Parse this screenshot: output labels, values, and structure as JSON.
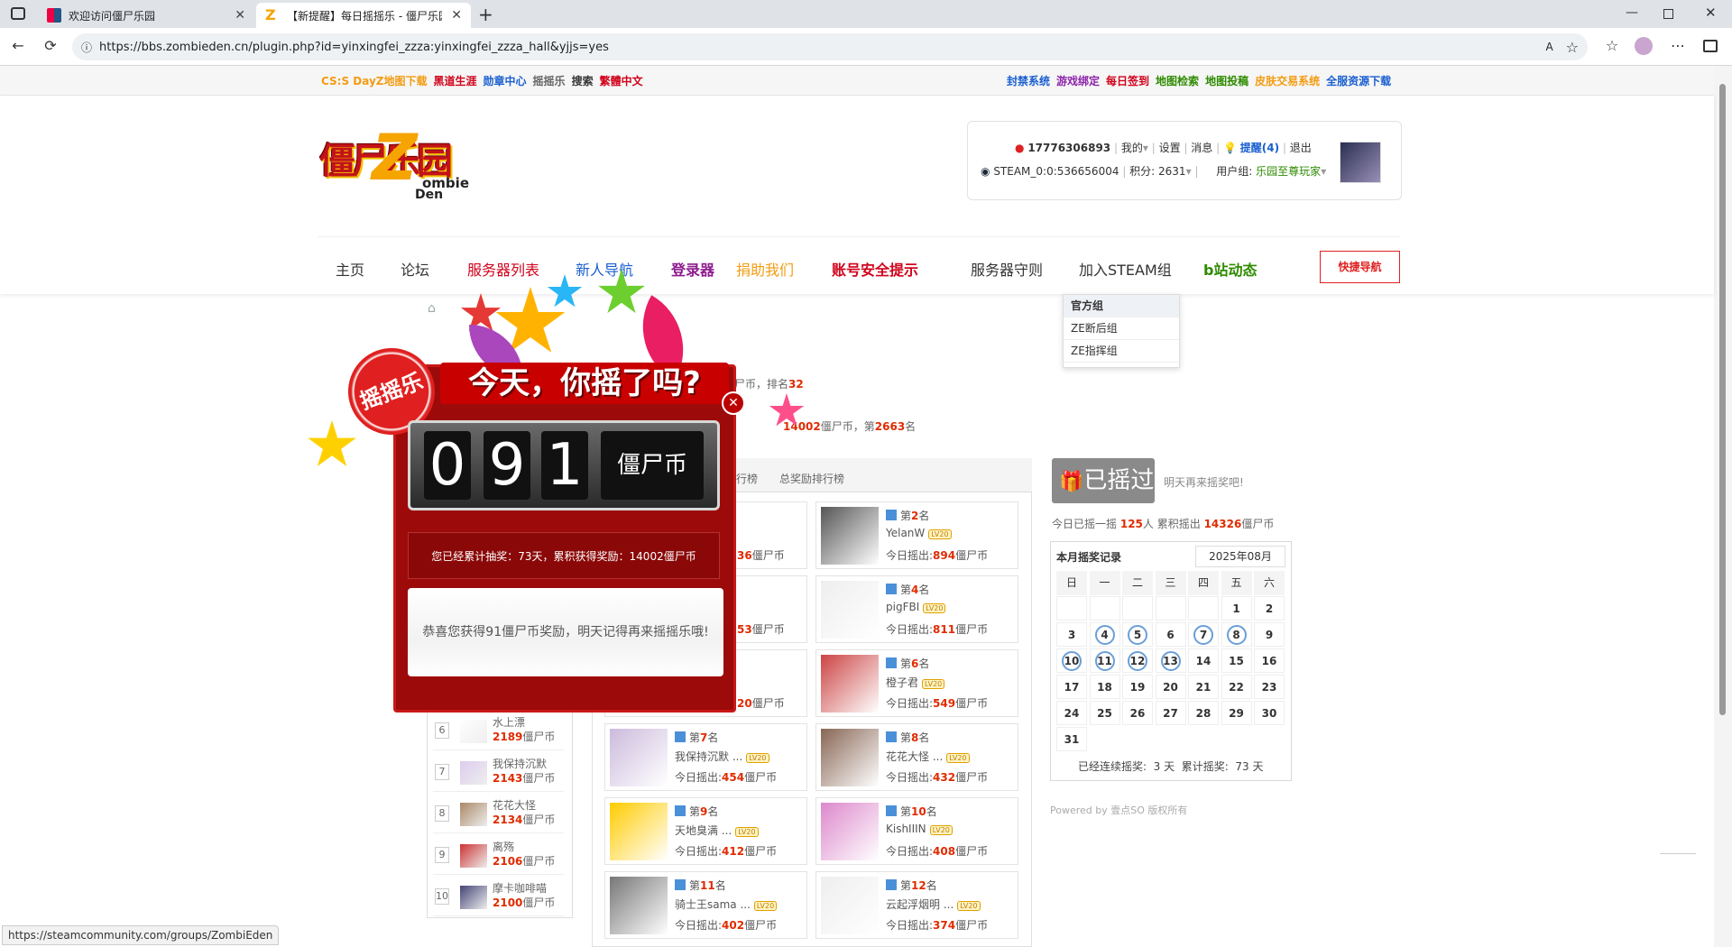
{
  "browser": {
    "tabs": [
      {
        "title": "欢迎访问僵尸乐园"
      },
      {
        "title": "【新提醒】每日摇摇乐 - 僵尸乐园"
      }
    ],
    "url": "https://bbs.zombieden.cn/plugin.php?id=yinxingfei_zzza:yinxingfei_zzza_hall&yjjs=yes",
    "status_url": "https://steamcommunity.com/groups/ZombiEden"
  },
  "topbar": {
    "left": [
      {
        "label": "CS:S DayZ地图下载",
        "color": "#f39c12"
      },
      {
        "label": "黑道生涯",
        "color": "#d0021b"
      },
      {
        "label": "勋章中心",
        "color": "#1a5fd0"
      },
      {
        "label": "摇摇乐",
        "color": "#666666"
      },
      {
        "label": "搜索",
        "color": "#333333"
      },
      {
        "label": "繁體中文",
        "color": "#d0021b"
      }
    ],
    "right": [
      {
        "label": "封禁系统",
        "color": "#1a5fd0"
      },
      {
        "label": "游戏绑定",
        "color": "#8e24aa"
      },
      {
        "label": "每日签到",
        "color": "#d0021b"
      },
      {
        "label": "地图检索",
        "color": "#2e8b00"
      },
      {
        "label": "地图投稿",
        "color": "#2e8b00"
      },
      {
        "label": "皮肤交易系统",
        "color": "#f39c12"
      },
      {
        "label": "全服资源下载",
        "color": "#1a5fd0"
      }
    ]
  },
  "logo": {
    "cn": "僵尸乐园",
    "en1": "ombie",
    "en2": "Den"
  },
  "user": {
    "qq": "17776306893",
    "my": "我的",
    "settings": "设置",
    "messages": "消息",
    "remind": "提醒(4)",
    "logout": "退出",
    "steam": "STEAM_0:0:536656004",
    "points": "积分: 2631",
    "group_label": "用户组:",
    "group": "乐园至尊玩家"
  },
  "nav": [
    {
      "label": "主页",
      "color": "#333333",
      "bold": false
    },
    {
      "label": "论坛",
      "color": "#333333",
      "bold": false
    },
    {
      "label": "服务器列表",
      "color": "#d0021b",
      "bold": false
    },
    {
      "label": "新人导航",
      "color": "#1a5fd0",
      "bold": false
    },
    {
      "label": "登录器",
      "color": "#8e1a8e",
      "bold": true
    },
    {
      "label": "捐助我们",
      "color": "#f39c12",
      "bold": false
    },
    {
      "label": "账号安全提示",
      "color": "#d0021b",
      "bold": true
    },
    {
      "label": "服务器守则",
      "color": "#333333",
      "bold": false
    },
    {
      "label": "加入STEAM组",
      "color": "#333333",
      "bold": false
    },
    {
      "label": "b站动态",
      "color": "#2e8b00",
      "bold": true
    }
  ],
  "quick_nav": "快捷导航",
  "dropdown": [
    "官方组",
    "ZE断后组",
    "ZE指挥组"
  ],
  "profile": {
    "rank_text": "僵尸币，排名",
    "rank": "32",
    "coins": "14002",
    "coins_suffix": "僵尸币，第",
    "pos": "2663",
    "pos_suffix": "名"
  },
  "tabs_rank": [
    "行榜",
    "总奖励排行榜"
  ],
  "popup": {
    "badge": "摇摇乐",
    "headline": "今天，你摇了吗?",
    "digits": [
      "0",
      "9",
      "1"
    ],
    "unit": "僵尸币",
    "summary": "您已经累计抽奖：73天，累积获得奖励：14002僵尸币",
    "message": "恭喜您获得91僵尸币奖励，明天记得再来摇摇乐哦!"
  },
  "cards": [
    {
      "rank": "2",
      "name": "YelanW",
      "amount": "894"
    },
    {
      "rank": "4",
      "name": "pigFBI",
      "amount": "811"
    },
    {
      "rank": "6",
      "name": "橙子君",
      "amount": "549"
    },
    {
      "rank": "7",
      "name": "我保持沉默 ...",
      "amount": "454"
    },
    {
      "rank": "8",
      "name": "花花大怪 ...",
      "amount": "432"
    },
    {
      "rank": "9",
      "name": "天地臭满 ...",
      "amount": "412"
    },
    {
      "rank": "10",
      "name": "KishIIIN",
      "amount": "408"
    },
    {
      "rank": "11",
      "name": "骑士王sama ...",
      "amount": "402"
    },
    {
      "rank": "12",
      "name": "云起浮烟明 ...",
      "amount": "374"
    }
  ],
  "partial_amounts": [
    "36",
    "53",
    "20"
  ],
  "card_labels": {
    "rank_pre": "第",
    "rank_post": "名",
    "today": "今日摇出:",
    "unit": "僵尸币",
    "lvl": "LV20"
  },
  "left_list": [
    {
      "n": "6",
      "name": "水上漂",
      "val": "2189"
    },
    {
      "n": "7",
      "name": "我保持沉默",
      "val": "2143"
    },
    {
      "n": "8",
      "name": "花花大怪",
      "val": "2134"
    },
    {
      "n": "9",
      "name": "离殇",
      "val": "2106"
    },
    {
      "n": "10",
      "name": "摩卡咖啡喵",
      "val": "2100"
    }
  ],
  "shaken": {
    "button": "已摇过",
    "hint": "明天再来摇奖吧!",
    "stats_pre": "今日已摇一摇",
    "people": "125",
    "stats_mid": "人 累积摇出",
    "total": "14326",
    "stats_post": "僵尸币"
  },
  "calendar": {
    "title": "本月摇奖记录",
    "month": "2025年08月",
    "weekdays": [
      "日",
      "一",
      "二",
      "三",
      "四",
      "五",
      "六"
    ],
    "days": [
      "",
      "",
      "",
      "",
      "",
      "1",
      "2",
      "3",
      "4",
      "5",
      "6",
      "7",
      "8",
      "9",
      "10",
      "11",
      "12",
      "13",
      "14",
      "15",
      "16",
      "17",
      "18",
      "19",
      "20",
      "21",
      "22",
      "23",
      "24",
      "25",
      "26",
      "27",
      "28",
      "29",
      "30",
      "31"
    ],
    "marked": [
      "4",
      "5",
      "7",
      "8",
      "10",
      "11",
      "12",
      "13"
    ],
    "footer": "已经连续摇奖:  3 天  累计摇奖:  73 天"
  },
  "powered": "Powered by 壹点SO 版权所有"
}
